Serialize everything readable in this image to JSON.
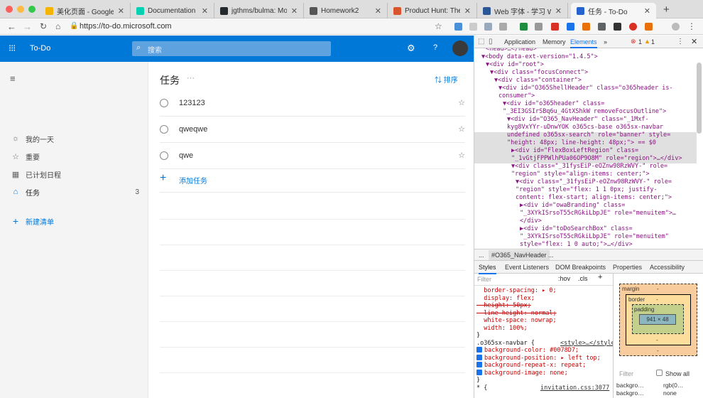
{
  "browser": {
    "tabs": [
      {
        "label": "美化页面 - Google",
        "color": "#f4b400"
      },
      {
        "label": "Documentation | Bu",
        "color": "#00d1b2"
      },
      {
        "label": "jgthms/bulma: Mod",
        "color": "#24292e"
      },
      {
        "label": "Homework2",
        "color": "#555555"
      },
      {
        "label": "Product Hunt: The best",
        "color": "#da552f"
      },
      {
        "label": "Web 字体 - 学习 We",
        "color": "#2b5797"
      },
      {
        "label": "任务 - To-Do",
        "color": "#2564cf"
      }
    ],
    "url": "https://to-do.microsoft.com"
  },
  "app": {
    "suite_title": "To-Do",
    "search_placeholder": "搜索",
    "help": "?",
    "sidebar": {
      "items": [
        {
          "label": "我的一天",
          "icon": "sun-icon",
          "glyph": "☼"
        },
        {
          "label": "重要",
          "icon": "star-icon",
          "glyph": "☆"
        },
        {
          "label": "已计划日程",
          "icon": "calendar-icon",
          "glyph": "▦"
        },
        {
          "label": "任务",
          "icon": "home-icon",
          "glyph": "⌂",
          "count": "3"
        }
      ],
      "new_list": "新建清单"
    },
    "main": {
      "title": "任务",
      "more": "···",
      "sort_label": "排序",
      "tasks": [
        "123123",
        "qweqwe",
        "qwe"
      ],
      "add_task": "添加任务"
    }
  },
  "devtools": {
    "tabs": [
      "Application",
      "Memory",
      "Elements",
      "»"
    ],
    "errors": "1",
    "warnings": "1",
    "dom_lines": [
      {
        "indent": 2,
        "text": "<head>…</head>"
      },
      {
        "indent": 1,
        "text": "▼<body data-ext-version=\"1.4.5\">"
      },
      {
        "indent": 2,
        "text": "▼<div id=\"root\">"
      },
      {
        "indent": 3,
        "text": "▼<div class=\"focusConnect\">"
      },
      {
        "indent": 4,
        "text": "▼<div class=\"container\">"
      },
      {
        "indent": 5,
        "text": "▼<div id=\"O365ShellHeader\" class=\"o365header is-"
      },
      {
        "indent": 5,
        "text": "consumer\">"
      },
      {
        "indent": 6,
        "text": "▼<div id=\"o365header\" class="
      },
      {
        "indent": 6,
        "text": "\"_3EI3GSIrSBq6u_4GtXShkW removeFocusOutline\">"
      },
      {
        "indent": 7,
        "text": "▼<div id=\"O365_NavHeader\" class=\"_1Mxf-"
      },
      {
        "indent": 7,
        "text": "kyg8VxYYr-uDnwYOK o365cs-base o365sx-navbar"
      },
      {
        "indent": 7,
        "text": "undefined o365sx-search\" role=\"banner\" style="
      },
      {
        "indent": 7,
        "text": "\"height: 48px; line-height: 48px;\"> == $0"
      },
      {
        "indent": 8,
        "text": "▶<div id=\"FlexBoxLeftRegion\" class="
      },
      {
        "indent": 8,
        "text": "\"_1vGtjFPPWlhPUa06OP9O8M\" role=\"region\">…</div>"
      },
      {
        "indent": 8,
        "text": "▼<div class=\"_31fysEiP-eOZnw98RzWVY-\" role="
      },
      {
        "indent": 8,
        "text": "\"region\" style=\"align-items: center;\">"
      },
      {
        "indent": 9,
        "text": "▼<div class=\"_31fysEiP-eOZnw98RzWVY-\" role="
      },
      {
        "indent": 9,
        "text": "\"region\" style=\"flex: 1 1 0px; justify-"
      },
      {
        "indent": 9,
        "text": "content: flex-start; align-items: center;\">"
      },
      {
        "indent": 10,
        "text": "▶<div id=\"owaBranding\" class="
      },
      {
        "indent": 10,
        "text": "\"_3XYkISrsoT55cRGkiLbpJE\" role=\"menuitem\">…"
      },
      {
        "indent": 10,
        "text": "</div>"
      },
      {
        "indent": 10,
        "text": "▶<div id=\"toDoSearchBox\" class="
      },
      {
        "indent": 10,
        "text": "\"_3XYkISrsoT55cRGkiLbpJE\" role=\"menuitem\""
      },
      {
        "indent": 10,
        "text": "style=\"flex: 1 0 auto;\">…</div>"
      }
    ],
    "breadcrumb": [
      "...",
      "#O365_NavHeader",
      "..."
    ],
    "subtabs": [
      "Styles",
      "Event Listeners",
      "DOM Breakpoints",
      "Properties",
      "Accessibility"
    ],
    "filter_placeholder": "Filter",
    "filter_hov": ":hov",
    "filter_cls": ".cls",
    "filter_plus": "+",
    "style_lines": [
      {
        "text": "  border-spacing: ▸ 0;",
        "kind": "prop"
      },
      {
        "text": "  display: flex;",
        "kind": "prop"
      },
      {
        "text": "  height: 50px;",
        "kind": "strike"
      },
      {
        "text": "  line-height: normal;",
        "kind": "strike"
      },
      {
        "text": "  white-space: nowrap;",
        "kind": "prop"
      },
      {
        "text": "  width: 100%;",
        "kind": "prop"
      },
      {
        "text": "}",
        "kind": "plain"
      },
      {
        "text": ".o365sx-navbar {",
        "kind": "plain",
        "source": "<style>…</style>"
      },
      {
        "text": "background-color: #0078D7;",
        "kind": "check"
      },
      {
        "text": "background-position: ▸ left top;",
        "kind": "check"
      },
      {
        "text": "background-repeat-x: repeat;",
        "kind": "check"
      },
      {
        "text": "background-image: none;",
        "kind": "check"
      },
      {
        "text": "}",
        "kind": "plain"
      },
      {
        "text": "* {",
        "kind": "plain",
        "source": "invitation.css:3077"
      }
    ],
    "box_model": {
      "margin": "margin",
      "border": "border",
      "padding": "padding",
      "content": "941 × 48",
      "dash": "-",
      "filter": "Filter",
      "show_all": "Show all",
      "computed": [
        {
          "prop": "backgro…",
          "value": "rgb(0…"
        },
        {
          "prop": "backgro…",
          "value": "none"
        }
      ]
    }
  },
  "colors": {
    "accent": "#0078d7",
    "sidebar": "#f4f4f4"
  }
}
